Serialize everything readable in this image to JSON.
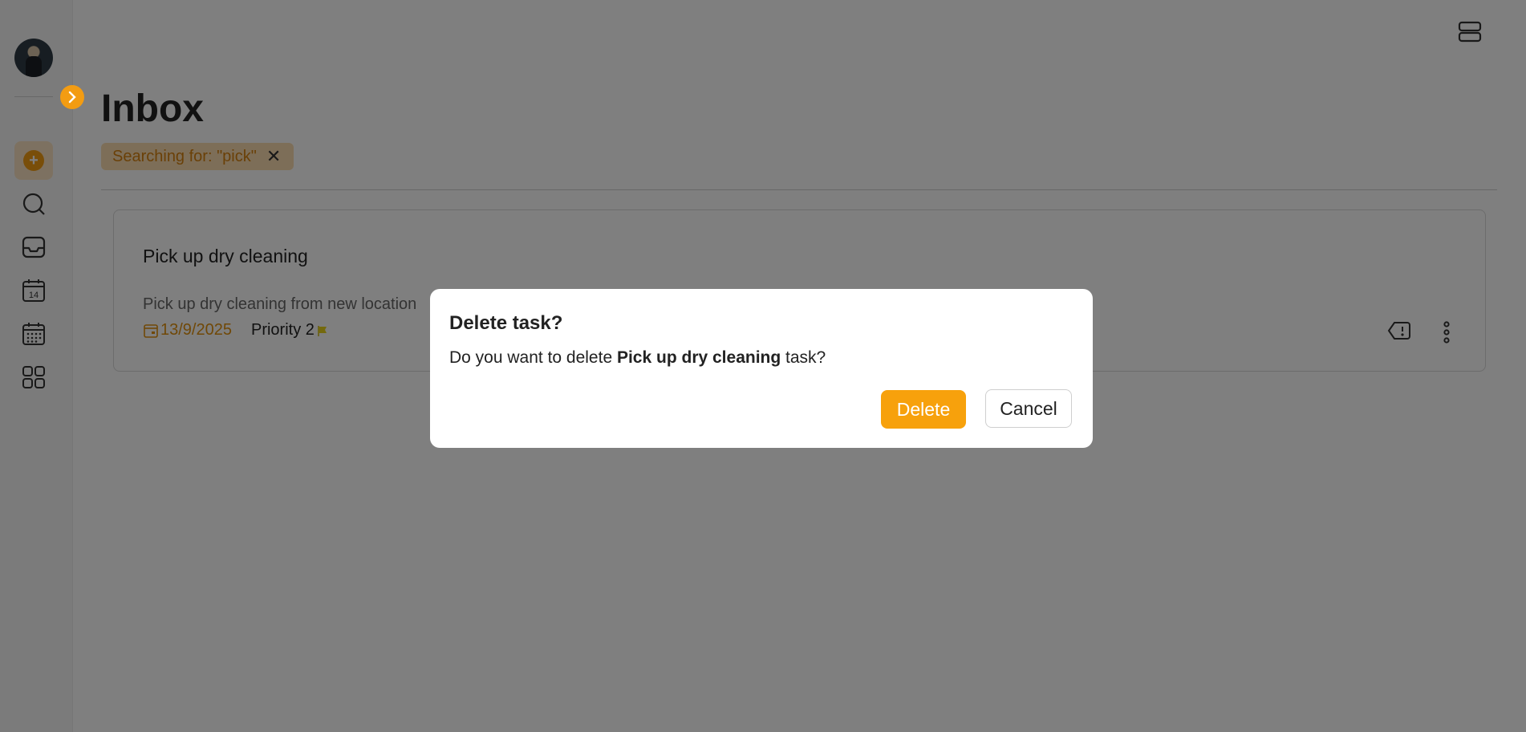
{
  "sidebar": {
    "collapse_icon": "chevron-right-icon",
    "items": [
      {
        "icon": "add-icon",
        "glyph": "+",
        "active": true
      },
      {
        "icon": "search-icon"
      },
      {
        "icon": "inbox-icon"
      },
      {
        "icon": "today-calendar-icon",
        "glyph": "14"
      },
      {
        "icon": "upcoming-calendar-icon"
      },
      {
        "icon": "grid-icon"
      }
    ]
  },
  "header": {
    "layout_icon": "layout-toggle-icon",
    "title": "Inbox",
    "search_chip": {
      "text": "Searching for: \"pick\"",
      "close": "✕"
    }
  },
  "task": {
    "title": "Pick up dry cleaning",
    "description": "Pick up dry cleaning from new location",
    "date": "13/9/2025",
    "priority": "Priority 2",
    "priority_color": "#e8d21a",
    "date_color": "#e0900f"
  },
  "dialog": {
    "title": "Delete task?",
    "body_prefix": "Do you want to delete ",
    "body_task": "Pick up dry cleaning",
    "body_suffix": " task?",
    "delete_label": "Delete",
    "cancel_label": "Cancel"
  },
  "colors": {
    "accent": "#f39c12",
    "delete_button": "#f7a10c",
    "overlay": "rgba(0,0,0,0.5)"
  }
}
